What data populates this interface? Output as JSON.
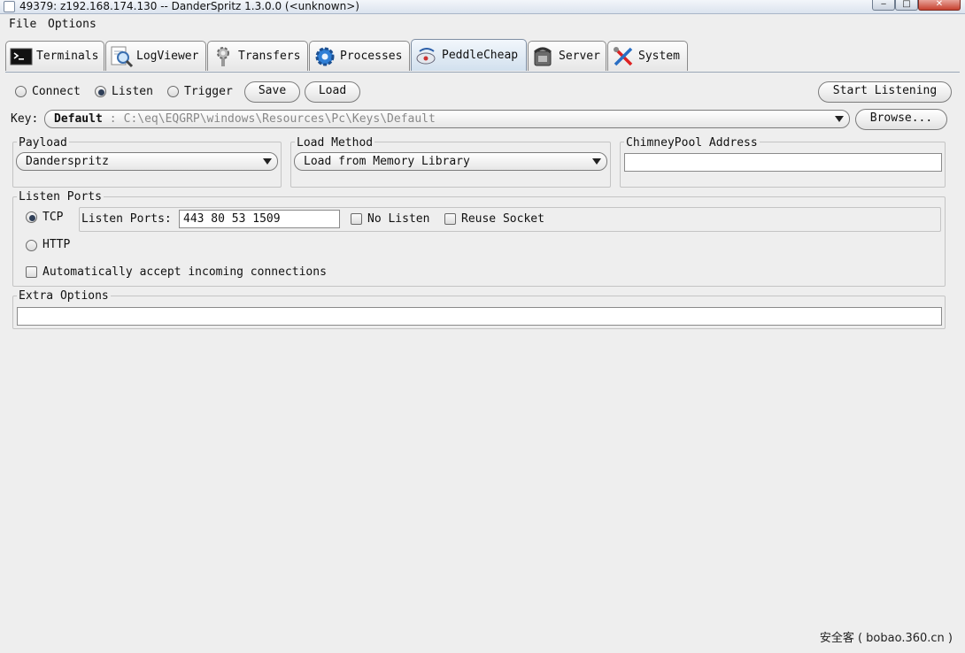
{
  "window": {
    "title": "49379: z192.168.174.130 -- DanderSpritz 1.3.0.0 (<unknown>)",
    "minimize_glyph": "‒",
    "maximize_glyph": "□",
    "close_glyph": "✕"
  },
  "menubar": {
    "items": [
      "File",
      "Options"
    ]
  },
  "tabs": {
    "items": [
      {
        "label": "Terminals",
        "icon": "terminal-icon"
      },
      {
        "label": "LogViewer",
        "icon": "magnifier-log-icon"
      },
      {
        "label": "Transfers",
        "icon": "transfer-gear-icon"
      },
      {
        "label": "Processes",
        "icon": "gears-icon"
      },
      {
        "label": "PeddleCheap",
        "icon": "peddlecheap-icon"
      },
      {
        "label": "Server",
        "icon": "phone-icon"
      },
      {
        "label": "System",
        "icon": "tools-icon"
      }
    ],
    "active": "PeddleCheap"
  },
  "mode": {
    "options": [
      "Connect",
      "Listen",
      "Trigger"
    ],
    "selected": "Listen",
    "save_label": "Save",
    "load_label": "Load",
    "start_label": "Start Listening"
  },
  "key": {
    "label": "Key:",
    "name": "Default",
    "separator": ":",
    "path": "C:\\eq\\EQGRP\\windows\\Resources\\Pc\\Keys\\Default",
    "browse_label": "Browse..."
  },
  "payload": {
    "legend": "Payload",
    "value": "Danderspritz"
  },
  "load_method": {
    "legend": "Load Method",
    "value": "Load from Memory Library"
  },
  "chimneypool": {
    "legend": "ChimneyPool Address",
    "value": ""
  },
  "listen_ports": {
    "legend": "Listen Ports",
    "tcp_label": "TCP",
    "http_label": "HTTP",
    "selected": "TCP",
    "ports_label": "Listen Ports:",
    "ports_value": "443 80 53 1509",
    "no_listen_label": "No Listen",
    "reuse_socket_label": "Reuse Socket",
    "auto_accept_label": "Automatically accept incoming connections"
  },
  "extra_options": {
    "legend": "Extra Options",
    "value": ""
  },
  "watermark": "安全客 ( bobao.360.cn )"
}
